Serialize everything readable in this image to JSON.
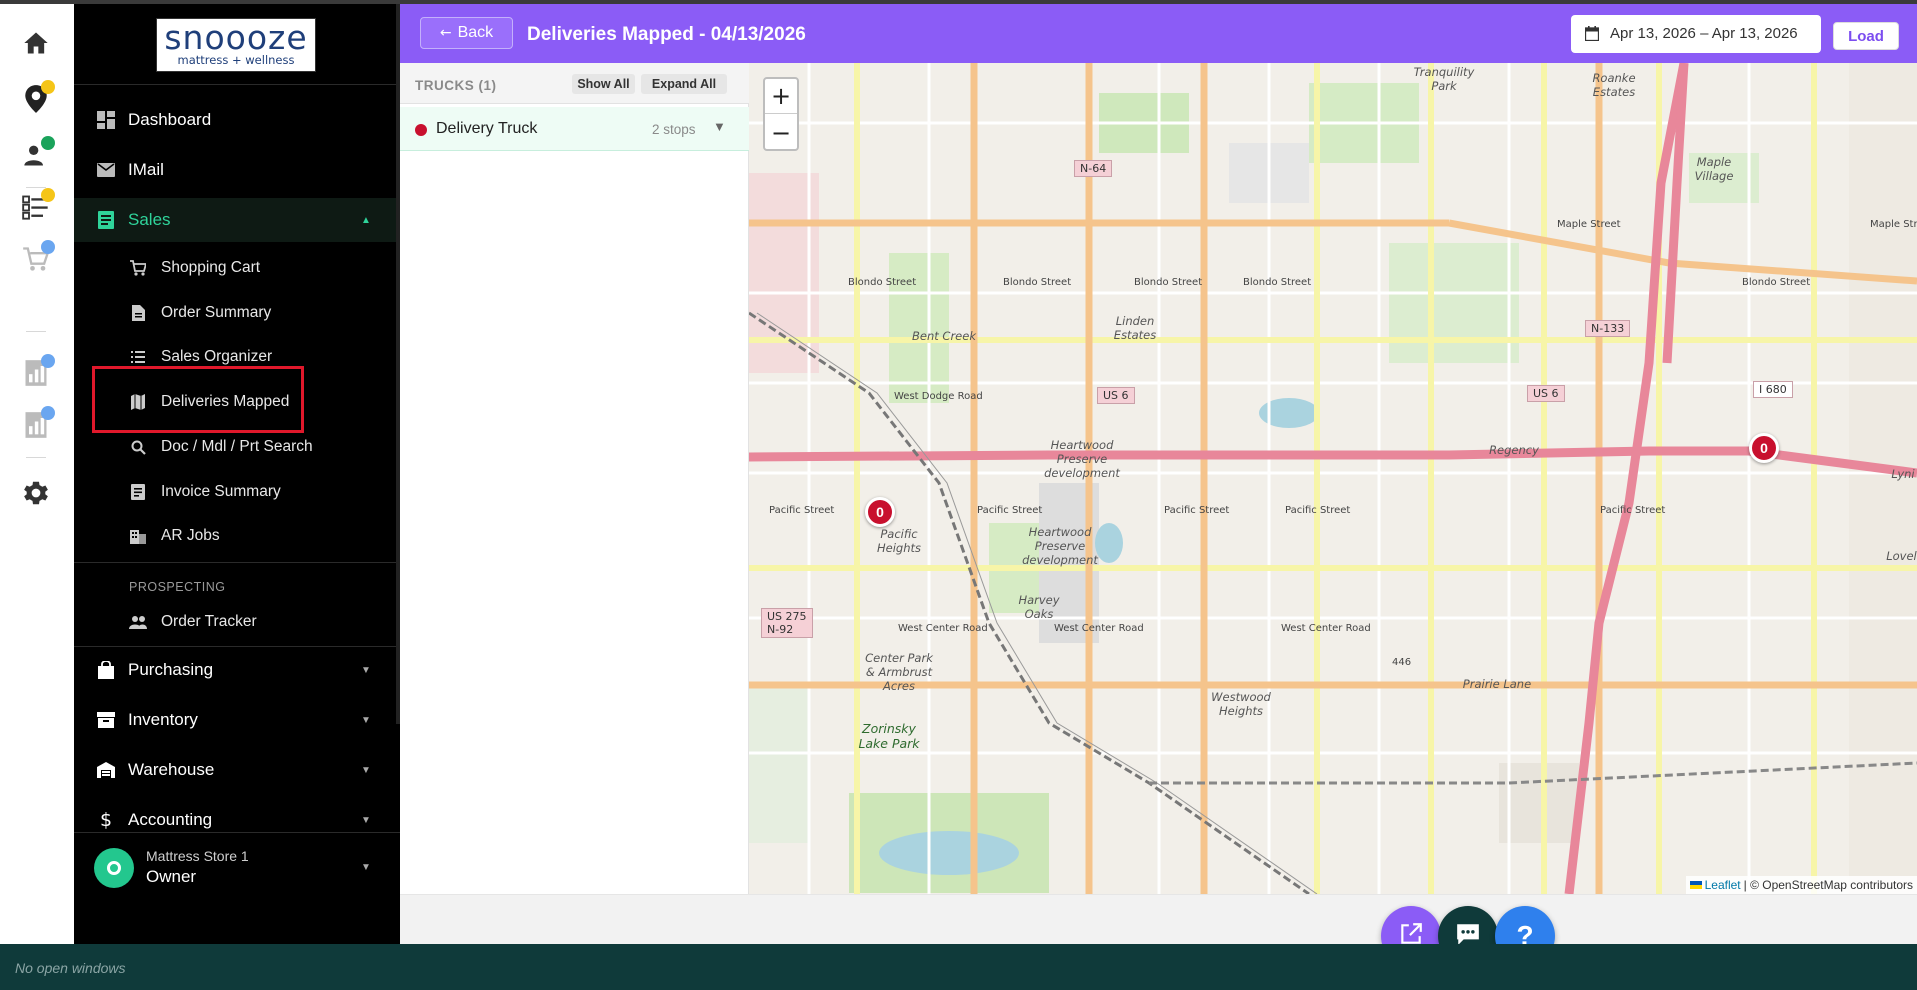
{
  "app": {
    "logo_main": "snoooze",
    "logo_sub": "mattress + wellness"
  },
  "sidebar": {
    "items": [
      {
        "label": "Dashboard",
        "icon": "dashboard-icon"
      },
      {
        "label": "IMail",
        "icon": "mail-icon"
      },
      {
        "label": "Sales",
        "icon": "sales-icon",
        "expanded": true
      },
      {
        "label": "Purchasing",
        "icon": "bag-icon"
      },
      {
        "label": "Inventory",
        "icon": "archive-icon"
      },
      {
        "label": "Warehouse",
        "icon": "warehouse-icon"
      },
      {
        "label": "Accounting",
        "icon": "dollar-icon"
      }
    ],
    "sales_sub": [
      {
        "label": "Shopping Cart",
        "icon": "cart-icon"
      },
      {
        "label": "Order Summary",
        "icon": "document-icon"
      },
      {
        "label": "Sales Organizer",
        "icon": "list-icon"
      },
      {
        "label": "Deliveries Mapped",
        "icon": "map-icon"
      },
      {
        "label": "Doc / Mdl / Prt Search",
        "icon": "search-icon"
      },
      {
        "label": "Invoice Summary",
        "icon": "invoice-icon"
      },
      {
        "label": "AR Jobs",
        "icon": "building-icon"
      }
    ],
    "section_prospecting": "PROSPECTING",
    "prospecting_items": [
      {
        "label": "Order Tracker",
        "icon": "people-icon"
      }
    ],
    "user": {
      "store": "Mattress Store 1",
      "role": "Owner"
    }
  },
  "header": {
    "back_label": "Back",
    "title": "Deliveries Mapped - 04/13/2026",
    "date_range": "Apr 13, 2026 – Apr 13, 2026",
    "load_label": "Load",
    "color": "#8b5cf6"
  },
  "trucks": {
    "title": "TRUCKS (1)",
    "show_all": "Show All",
    "expand_all": "Expand All",
    "rows": [
      {
        "name": "Delivery Truck",
        "stops": "2 stops",
        "color": "#c8102e"
      }
    ]
  },
  "map": {
    "attribution_link": "Leaflet",
    "attribution_text": "| © OpenStreetMap contributors",
    "markers": [
      "0",
      "0"
    ],
    "streets": {
      "n64": "N-64",
      "maple": "Maple Street",
      "maple2": "Maple Stre",
      "blondo1": "Blondo Street",
      "blondo2": "Blondo Street",
      "blondo3": "Blondo Street",
      "blondo4": "Blondo Street",
      "blondo5": "Blondo Street",
      "n133": "N-133",
      "dodge": "West Dodge Road",
      "us6a": "US 6",
      "i680": "I 680",
      "us6b": "US 6",
      "pacific1": "Pacific Street",
      "pacific2": "Pacific Street",
      "pacific3": "Pacific Street",
      "pacific4": "Pacific Street",
      "pacific5": "Pacific Street",
      "center1": "West Center Road",
      "center2": "West Center Road",
      "center3": "West Center Road",
      "center4": "West Center Road",
      "us275a": "US 275",
      "us275b": "N-92",
      "i446": "446"
    },
    "places": {
      "tranquility": "Tranquility Park",
      "roanoke": "Roanke Estates",
      "maplevillage": "Maple Village",
      "bentcreek": "Bent Creek",
      "linden": "Linden Estates",
      "heartwood1": "Heartwood Preserve development",
      "heartwood2": "Heartwood Preserve development",
      "regency": "Regency",
      "pacificheights": "Pacific Heights",
      "harvey": "Harvey Oaks",
      "centerpark": "Center Park & Armbrust Acres",
      "zorinsky": "Zorinsky Lake Park",
      "westwood": "Westwood Heights",
      "prairie": "Prairie Lane",
      "lynx": "Lyni",
      "loveland": "Lovel"
    }
  },
  "taskbar": {
    "text": "No open windows"
  }
}
